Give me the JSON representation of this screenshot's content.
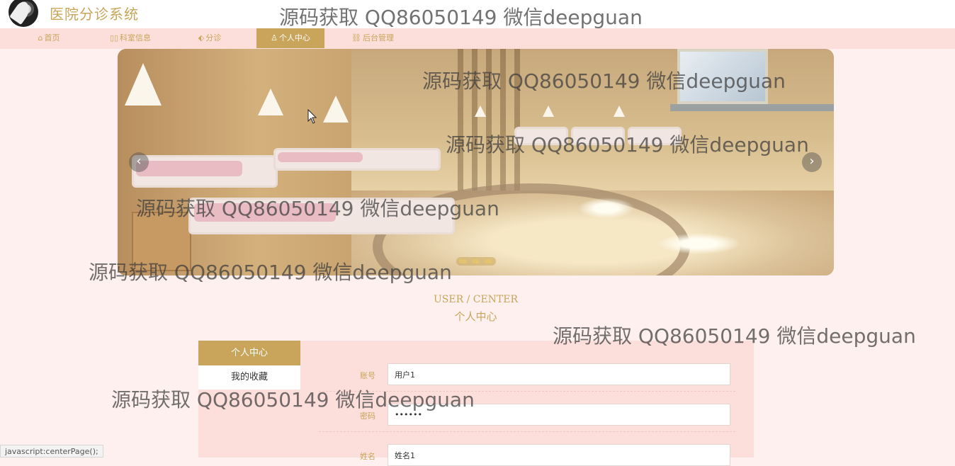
{
  "header": {
    "title": "医院分诊系统"
  },
  "nav": {
    "items": [
      {
        "label": "首页",
        "icon": "home-icon",
        "glyph": "⌂"
      },
      {
        "label": "科室信息",
        "icon": "columns-icon",
        "glyph": "▯▯"
      },
      {
        "label": "分诊",
        "icon": "tag-icon",
        "glyph": "⬖"
      },
      {
        "label": "个人中心",
        "icon": "user-icon",
        "glyph": "♙",
        "active": true
      },
      {
        "label": "后台管理",
        "icon": "link-icon",
        "glyph": "⛓"
      }
    ]
  },
  "banner": {
    "prev_glyph": "‹",
    "next_glyph": "›",
    "slide_count": 3,
    "active_slide": 1
  },
  "section": {
    "title_en": "USER / CENTER",
    "title_cn": "个人中心"
  },
  "sidebar": {
    "items": [
      {
        "label": "个人中心",
        "active": true
      },
      {
        "label": "我的收藏",
        "active": false
      }
    ]
  },
  "form": {
    "fields": [
      {
        "label": "账号",
        "value": "用户1"
      },
      {
        "label": "密码",
        "value": "••••••"
      },
      {
        "label": "姓名",
        "value": "姓名1"
      }
    ]
  },
  "watermark": {
    "text": "源码获取 QQ86050149 微信deepguan"
  },
  "status_bar": {
    "text": "javascript:centerPage();"
  },
  "colors": {
    "accent": "#c8a55a",
    "nav_bg": "#fcdedb",
    "page_bg": "#fdf0ee"
  }
}
